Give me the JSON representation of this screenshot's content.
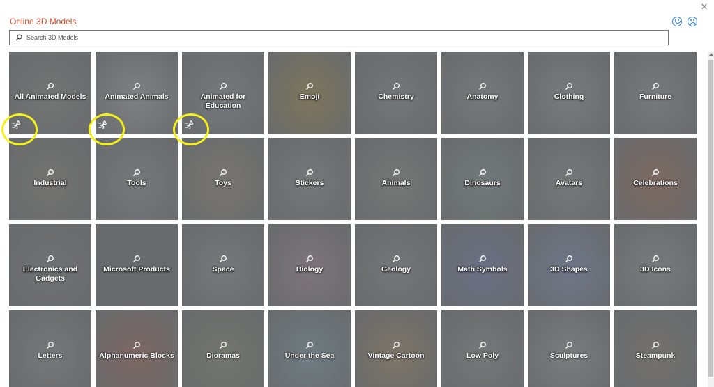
{
  "window": {
    "title": "Online 3D Models",
    "close_glyph": "✕"
  },
  "search": {
    "placeholder": "Search 3D Models",
    "value": ""
  },
  "feedback": {
    "happy_icon": "smiley-happy-icon",
    "sad_icon": "smiley-sad-icon"
  },
  "colors": {
    "title": "#d24726",
    "highlight_ring": "#f5f01a",
    "accent": "#2b7bd6",
    "tile_bg": "#8e9294"
  },
  "categories": [
    {
      "label": "All Animated Models",
      "bg": "#8a8f8b",
      "animated": true
    },
    {
      "label": "Animated Animals",
      "bg": "#9c9fa3",
      "animated": true
    },
    {
      "label": "Animated for Education",
      "bg": "#8f9396",
      "animated": true
    },
    {
      "label": "Emoji",
      "bg": "#9a8f6a"
    },
    {
      "label": "Chemistry",
      "bg": "#8c9093"
    },
    {
      "label": "Anatomy",
      "bg": "#8f9294"
    },
    {
      "label": "Clothing",
      "bg": "#929597"
    },
    {
      "label": "Furniture",
      "bg": "#8f9499"
    },
    {
      "label": "Industrial",
      "bg": "#8d8b89"
    },
    {
      "label": "Tools",
      "bg": "#8f9395"
    },
    {
      "label": "Toys",
      "bg": "#938f89"
    },
    {
      "label": "Stickers",
      "bg": "#8e9192"
    },
    {
      "label": "Animals",
      "bg": "#8f918f"
    },
    {
      "label": "Dinosaurs",
      "bg": "#8a9495"
    },
    {
      "label": "Avatars",
      "bg": "#8f9193"
    },
    {
      "label": "Celebrations",
      "bg": "#9a7c70"
    },
    {
      "label": "Electronics and Gadgets",
      "bg": "#868a8c"
    },
    {
      "label": "Microsoft Products",
      "bg": "#7d7f84"
    },
    {
      "label": "Space",
      "bg": "#8f9294"
    },
    {
      "label": "Biology",
      "bg": "#9a8d98"
    },
    {
      "label": "Geology",
      "bg": "#8c9091"
    },
    {
      "label": "Math Symbols",
      "bg": "#7f88a6"
    },
    {
      "label": "3D Shapes",
      "bg": "#8590ab"
    },
    {
      "label": "3D Icons",
      "bg": "#939596"
    },
    {
      "label": "Letters",
      "bg": "#8e9193"
    },
    {
      "label": "Alphanumeric Blocks",
      "bg": "#9a7a74"
    },
    {
      "label": "Dioramas",
      "bg": "#8a9083"
    },
    {
      "label": "Under the Sea",
      "bg": "#8598a0"
    },
    {
      "label": "Vintage Cartoon",
      "bg": "#9a8d7a"
    },
    {
      "label": "Low Poly",
      "bg": "#8e9193"
    },
    {
      "label": "Sculptures",
      "bg": "#95979a"
    },
    {
      "label": "Steampunk",
      "bg": "#8c8985"
    }
  ]
}
